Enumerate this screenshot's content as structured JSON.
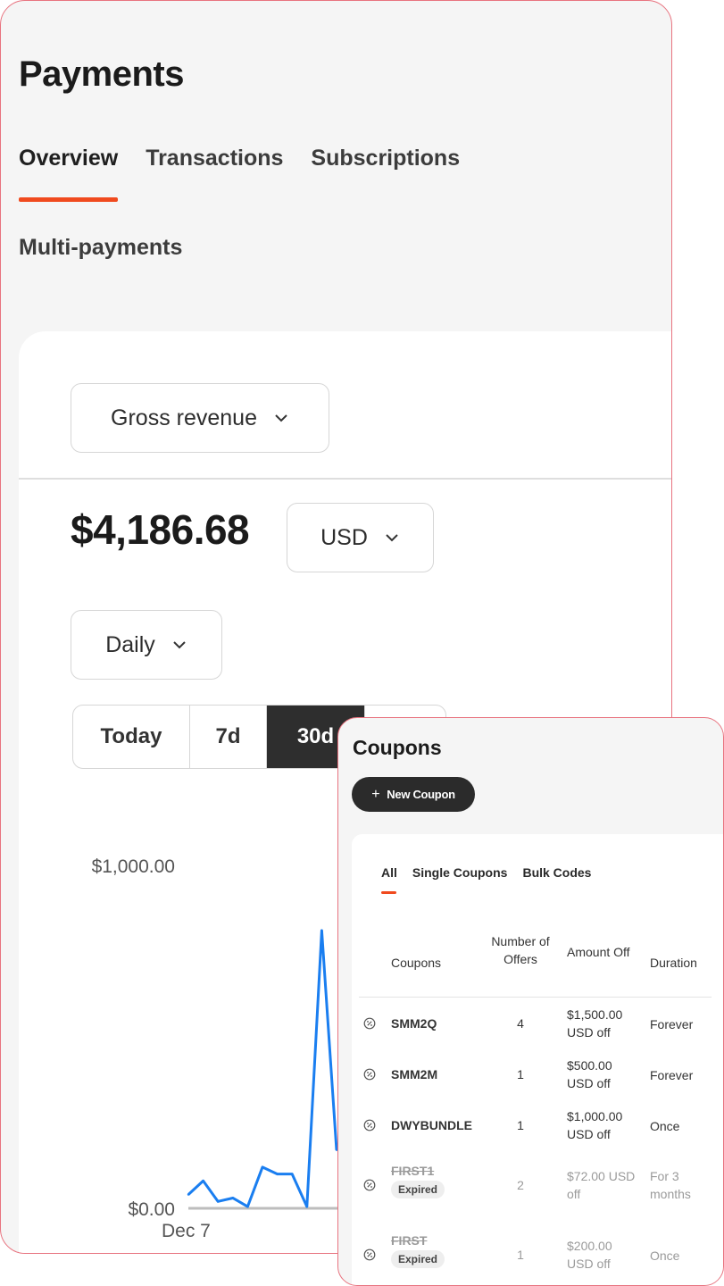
{
  "payments": {
    "title": "Payments",
    "tabs": [
      {
        "label": "Overview",
        "active": true
      },
      {
        "label": "Transactions",
        "active": false
      },
      {
        "label": "Subscriptions",
        "active": false
      },
      {
        "label": "Multi-payments",
        "active": false
      }
    ],
    "metric_select": "Gross revenue",
    "amount": "$4,186.68",
    "currency_select": "USD",
    "interval_select": "Daily",
    "ranges": [
      {
        "label": "Today",
        "active": false
      },
      {
        "label": "7d",
        "active": false
      },
      {
        "label": "30d",
        "active": true
      },
      {
        "label": "",
        "active": false
      }
    ],
    "accent_color": "#f04a1e",
    "line_color": "#1a7ef0"
  },
  "chart_data": {
    "type": "line",
    "y_tick_labels": [
      "$1,000.00",
      "$0.00"
    ],
    "ylim": [
      0,
      1000
    ],
    "x_tick_labels": [
      "Dec 7"
    ],
    "series": [
      {
        "values": [
          40,
          80,
          20,
          30,
          5,
          120,
          100,
          100,
          5,
          810,
          170
        ]
      }
    ]
  },
  "coupons": {
    "title": "Coupons",
    "new_button": "New Coupon",
    "tabs": [
      {
        "label": "All",
        "active": true
      },
      {
        "label": "Single Coupons",
        "active": false
      },
      {
        "label": "Bulk Codes",
        "active": false
      }
    ],
    "columns": {
      "coupons": "Coupons",
      "offers": "Number of Offers",
      "amount": "Amount Off",
      "duration": "Duration"
    },
    "rows": [
      {
        "code": "SMM2Q",
        "offers": "4",
        "amount": "$1,500.00 USD off",
        "duration": "Forever",
        "expired": false,
        "badge": ""
      },
      {
        "code": "SMM2M",
        "offers": "1",
        "amount": "$500.00 USD off",
        "duration": "Forever",
        "expired": false,
        "badge": ""
      },
      {
        "code": "DWYBUNDLE",
        "offers": "1",
        "amount": "$1,000.00 USD off",
        "duration": "Once",
        "expired": false,
        "badge": ""
      },
      {
        "code": "FIRST1",
        "offers": "2",
        "amount": "$72.00 USD off",
        "duration": "For 3 months",
        "expired": true,
        "badge": "Expired"
      },
      {
        "code": "FIRST",
        "offers": "1",
        "amount": "$200.00 USD off",
        "duration": "Once",
        "expired": true,
        "badge": "Expired"
      }
    ]
  }
}
